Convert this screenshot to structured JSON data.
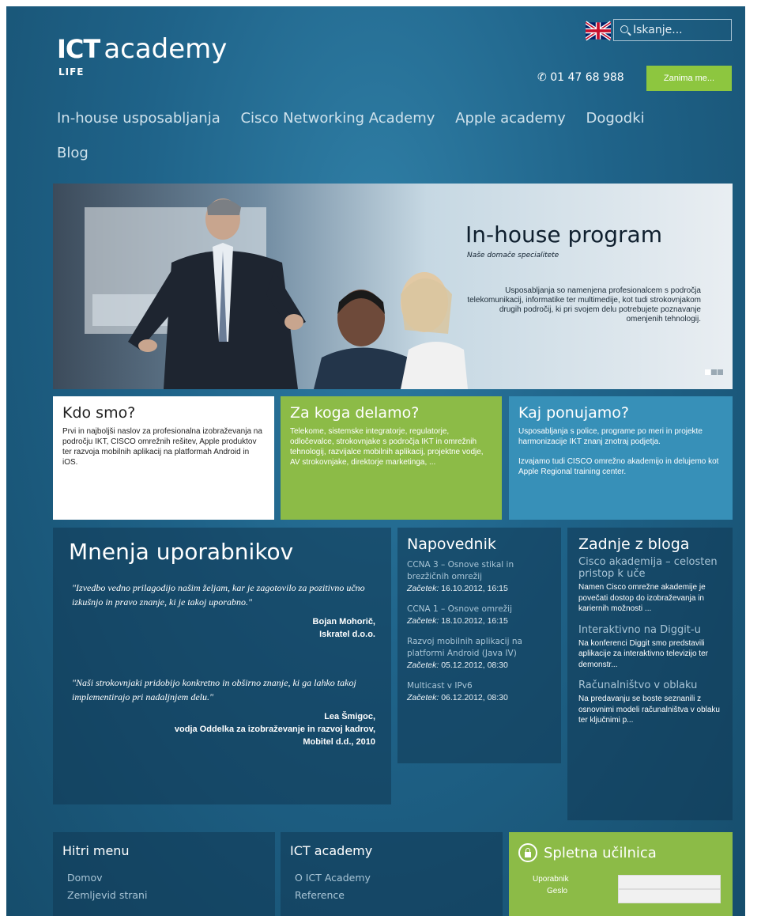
{
  "header": {
    "logo_ict": "ICT",
    "logo_academy": "academy",
    "logo_sub": "LIFE",
    "search_placeholder": "Iskanje...",
    "phone": "01 47 68 988",
    "cta": "Zanima me..."
  },
  "nav": [
    "In-house usposabljanja",
    "Cisco Networking Academy",
    "Apple academy",
    "Dogodki",
    "Blog"
  ],
  "hero": {
    "title": "In-house program",
    "subtitle": "Naše domače specialitete",
    "text": "Usposabljanja so namenjena profesionalcem s področja telekomunikacij, informatike ter multimedije, kot tudi strokovnjakom drugih področij, ki pri svojem delu potrebujete poznavanje omenjenih tehnologij."
  },
  "boxes": [
    {
      "title": "Kdo smo?",
      "text": "Prvi in najboljši naslov za profesionalna izobraževanja na področju IKT, CISCO omrežnih rešitev, Apple produktov ter razvoja mobilnih aplikacij na platformah Android in iOS."
    },
    {
      "title": "Za koga delamo?",
      "text": "Telekome, sistemske integratorje, regulatorje, odločevalce, strokovnjake s področja IKT in omrežnih tehnologij, razvijalce mobilnih aplikacij, projektne vodje, AV strokovnjake, direktorje marketinga, ..."
    },
    {
      "title": "Kaj ponujamo?",
      "text": "Usposabljanja s police, programe po meri in projekte harmonizacije IKT znanj znotraj podjetja.",
      "text2": "Izvajamo tudi CISCO omrežno akademijo in delujemo kot Apple Regional training center."
    }
  ],
  "testimonials": {
    "title": "Mnenja uporabnikov",
    "items": [
      {
        "quote": "\"Izvedbo vedno prilagodijo našim željam, kar je zagotovilo za pozitivno učno izkušnjo in pravo znanje, ki je takoj uporabno.\"",
        "author1": "Bojan Mohorič,",
        "author2": "Iskratel d.o.o."
      },
      {
        "quote": "\"Naši strokovnjaki pridobijo konkretno in obširno znanje, ki ga lahko takoj implementirajo pri nadaljnjem delu.\"",
        "author1": "Lea Šmigoc,",
        "author2": "vodja Oddelka za izobraževanje in razvoj kadrov,",
        "author3": "Mobitel d.d., 2010"
      }
    ]
  },
  "events": {
    "title": "Napovednik",
    "label": "Začetek:",
    "items": [
      {
        "name": "CCNA 3 – Osnove stikal in brezžičnih omrežij",
        "date": "16.10.2012, 16:15"
      },
      {
        "name": "CCNA 1 – Osnove omrežij",
        "date": "18.10.2012, 16:15"
      },
      {
        "name": "Razvoj mobilnih aplikacij na platformi Android (Java IV)",
        "date": "05.12.2012, 08:30"
      },
      {
        "name": "Multicast v IPv6",
        "date": "06.12.2012, 08:30"
      }
    ]
  },
  "blog": {
    "title": "Zadnje z bloga",
    "posts": [
      {
        "title": "Cisco akademija – celosten pristop k uče",
        "excerpt": "Namen Cisco omrežne akademije je povečati dostop do izobraževanja in kariernih možnosti ..."
      },
      {
        "title": "Interaktivno na Diggit-u",
        "excerpt": "Na konferenci Diggit smo predstavili aplikacije za interaktivno televizijo ter demonstr..."
      },
      {
        "title": "Računalništvo v oblaku",
        "excerpt": "Na predavanju se boste seznanili z osnovnimi modeli računalništva v oblaku ter ključnimi p..."
      }
    ]
  },
  "footer": {
    "quick": {
      "title": "Hitri menu",
      "links": [
        "Domov",
        "Zemljevid strani"
      ]
    },
    "ict": {
      "title": "ICT academy",
      "links": [
        "O ICT Academy",
        "Reference"
      ]
    },
    "login": {
      "title": "Spletna učilnica",
      "user_label": "Uporabnik",
      "pass_label": "Geslo"
    }
  },
  "colors": {
    "accent_green": "#8cbb47",
    "accent_blue": "#3790b8",
    "background": "#1f6389"
  }
}
